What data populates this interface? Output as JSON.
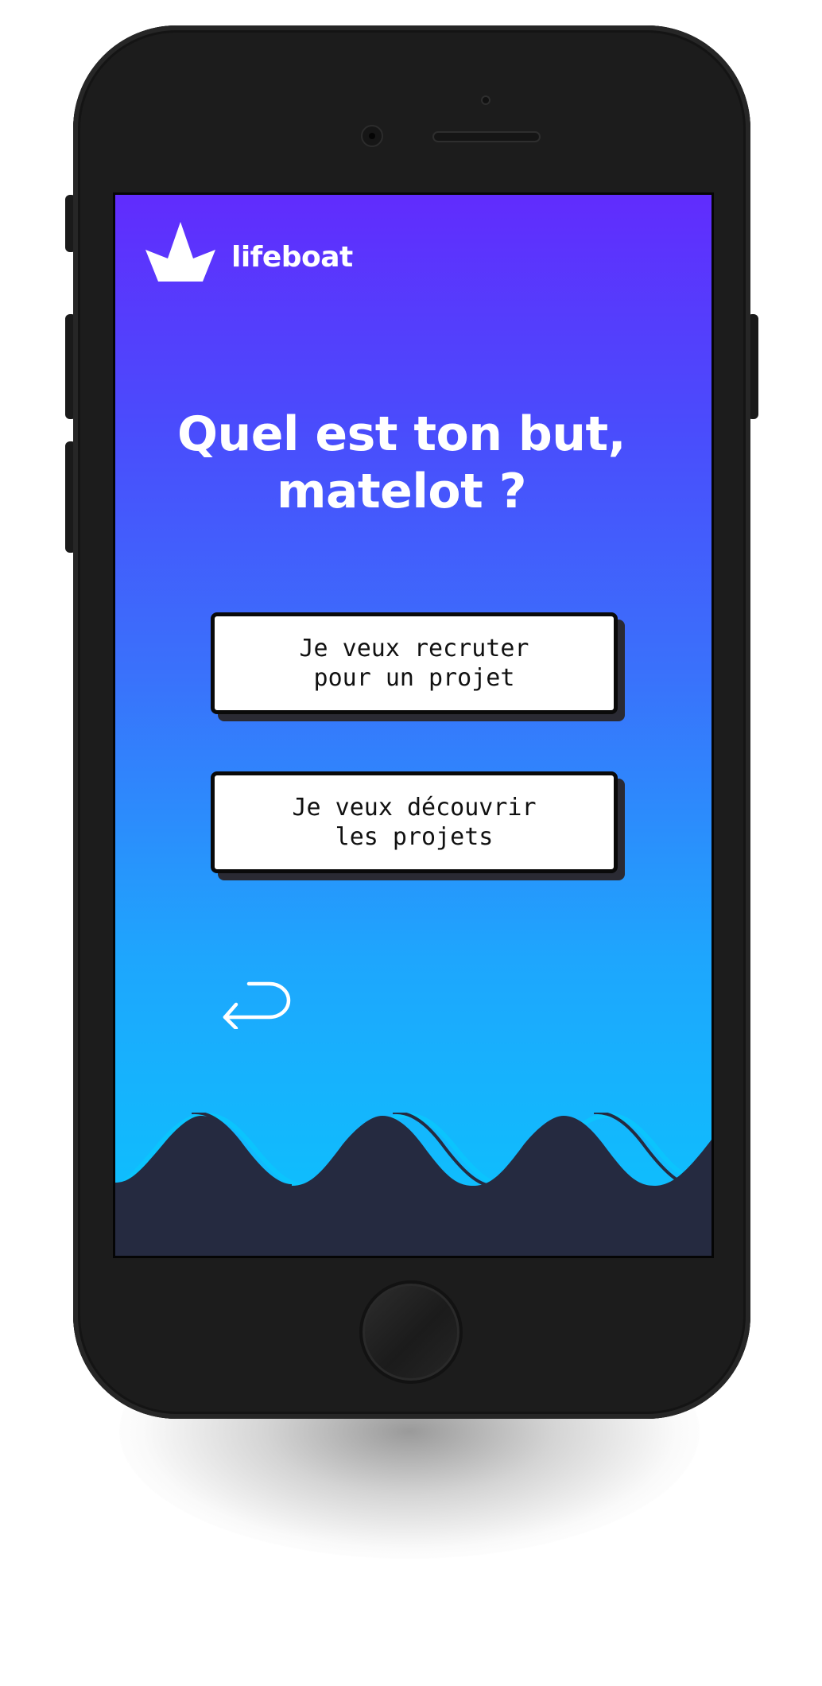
{
  "app": {
    "brand_name": "lifeboat",
    "logo_icon": "crown-icon"
  },
  "onboarding": {
    "headline_line1": "Quel est ton but,",
    "headline_line2": "matelot ?",
    "option_recruit": "Je veux recruter\npour un projet",
    "option_discover": "Je veux découvrir\nles projets",
    "back_icon": "return-arrow-icon"
  },
  "colors": {
    "gradient_top": "#612cfd",
    "gradient_bottom": "#0bc4fd",
    "wave_dark": "#252a40",
    "button_bg": "#ffffff",
    "button_shadow": "#2a2a33",
    "phone_body": "#1c1c1c"
  }
}
